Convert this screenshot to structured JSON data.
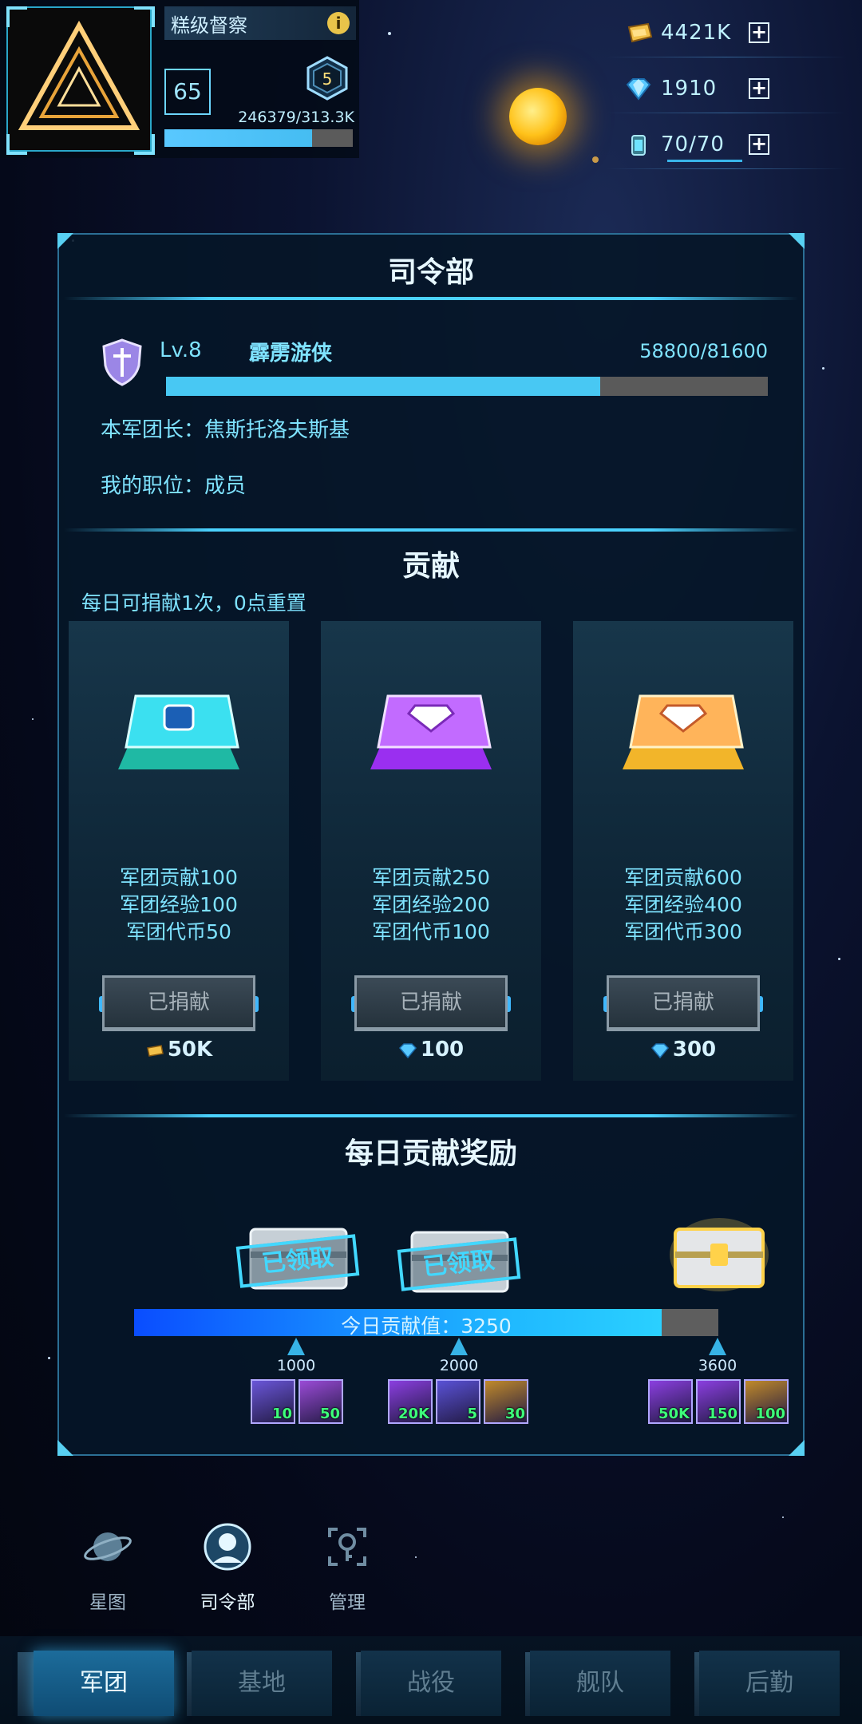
{
  "player": {
    "name": "糕级督察",
    "level": "65",
    "rank": "5",
    "exp_text": "246379/313.3K",
    "exp_fraction": 0.786
  },
  "resources": [
    {
      "name": "gold",
      "icon": "gold-bar-icon",
      "value": "4421K"
    },
    {
      "name": "diamond",
      "icon": "diamond-icon",
      "value": "1910"
    },
    {
      "name": "energy",
      "icon": "energy-canister-icon",
      "value": "70/70",
      "fraction": 1.0
    }
  ],
  "hq": {
    "title": "司令部",
    "legion_level": "Lv.8",
    "legion_name": "霹雳游侠",
    "legion_exp_text": "58800/81600",
    "legion_exp_fraction": 0.721,
    "leader_line": "本军团长：焦斯托洛夫斯基",
    "position_line": "我的职位：成员"
  },
  "contribution": {
    "title": "贡献",
    "note": "每日可捐献1次，0点重置",
    "button_label": "已捐献",
    "cards": [
      {
        "chest_color": "#2fd6c9",
        "rewards": [
          "军团贡献100",
          "军团经验100",
          "军团代币50"
        ],
        "cost": "50K",
        "cost_icon": "gold-bar-icon"
      },
      {
        "chest_color": "#b04cff",
        "rewards": [
          "军团贡献250",
          "军团经验200",
          "军团代币100"
        ],
        "cost": "100",
        "cost_icon": "diamond-icon"
      },
      {
        "chest_color": "#ffc23d",
        "rewards": [
          "军团贡献600",
          "军团经验400",
          "军团代币300"
        ],
        "cost": "300",
        "cost_icon": "diamond-icon"
      }
    ]
  },
  "daily": {
    "title": "每日贡献奖励",
    "claimed_label": "已领取",
    "progress_text": "今日贡献值：3250",
    "progress_fraction": 0.903,
    "milestones": [
      {
        "label": "1000",
        "items": [
          {
            "count": "10",
            "color": "#6a56d8"
          },
          {
            "count": "50",
            "color": "#9a4bd6"
          }
        ]
      },
      {
        "label": "2000",
        "items": [
          {
            "count": "20K",
            "color": "#8b3fe0"
          },
          {
            "count": "5",
            "color": "#5a52d6"
          },
          {
            "count": "30",
            "color": "#c08a2a"
          }
        ]
      },
      {
        "label": "3600",
        "items": [
          {
            "count": "50K",
            "color": "#8b3fe0"
          },
          {
            "count": "150",
            "color": "#8b3fe0"
          },
          {
            "count": "100",
            "color": "#c08a2a"
          }
        ]
      }
    ]
  },
  "subnav": [
    {
      "label": "星图",
      "icon": "planet-icon"
    },
    {
      "label": "司令部",
      "icon": "commander-icon",
      "active": true
    },
    {
      "label": "管理",
      "icon": "manage-icon"
    }
  ],
  "tabs": [
    {
      "label": "军团",
      "active": true
    },
    {
      "label": "基地"
    },
    {
      "label": "战役"
    },
    {
      "label": "舰队"
    },
    {
      "label": "后勤"
    }
  ]
}
